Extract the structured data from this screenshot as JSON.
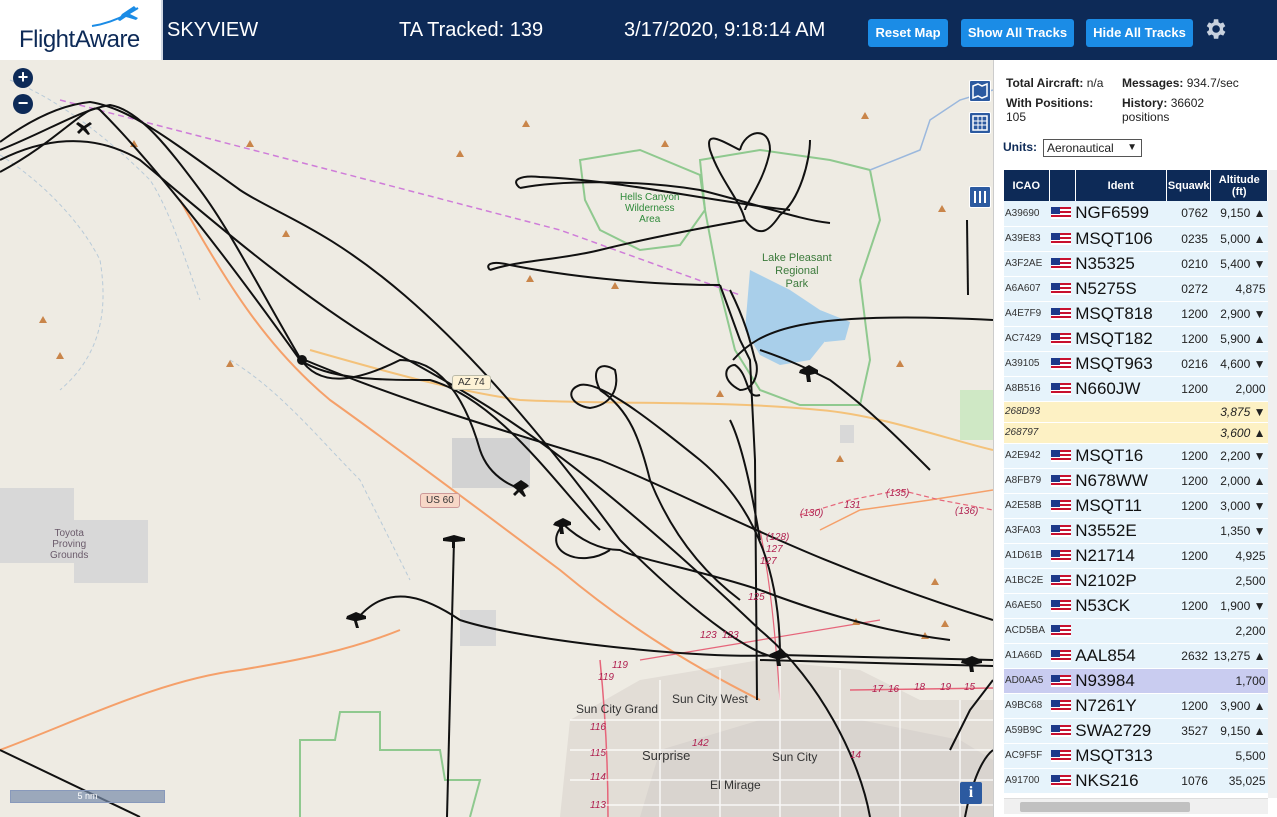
{
  "header": {
    "logo_text": "FlightAware",
    "app_title": "SKYVIEW",
    "tracked": "TA Tracked: 139",
    "datetime": "3/17/2020, 9:18:14 AM",
    "buttons": {
      "reset": "Reset Map",
      "show_all": "Show All Tracks",
      "hide_all": "Hide All Tracks"
    }
  },
  "map": {
    "zoom_in": "+",
    "zoom_out": "−",
    "scale": "5 nm",
    "info": "i",
    "labels": {
      "hells_canyon": "Hells Canyon\nWilderness\nArea",
      "lake_pleasant": "Lake Pleasant\nRegional\nPark",
      "toyota": "Toyota\nProving\nGrounds",
      "az74": "AZ 74",
      "us60": "US 60",
      "sun_city_grand": "Sun City Grand",
      "sun_city_west": "Sun City West",
      "surprise": "Surprise",
      "sun_city": "Sun City",
      "el_mirage": "El Mirage"
    },
    "route_numbers": [
      "(128)",
      "127",
      "127",
      "125",
      "123",
      "123",
      "119",
      "119",
      "116",
      "115",
      "114",
      "113",
      "142",
      "131",
      "(130)",
      "(135)",
      "(136)",
      "14",
      "17",
      "16",
      "18",
      "19",
      "15"
    ]
  },
  "panel": {
    "stats": {
      "total_label": "Total Aircraft:",
      "total_value": "n/a",
      "messages_label": "Messages:",
      "messages_value": "934.7/sec",
      "positions_label": "With Positions:",
      "positions_value": "105",
      "history_label": "History:",
      "history_value": "36602",
      "history_unit": "positions"
    },
    "units_label": "Units:",
    "units_value": "Aeronautical",
    "columns": [
      "ICAO",
      "",
      "Ident",
      "Squawk",
      "Altitude (ft)"
    ],
    "rows": [
      {
        "icao": "A39690",
        "ident": "NGF6599",
        "squawk": "0762",
        "alt": "9,150 ▲"
      },
      {
        "icao": "A39E83",
        "ident": "MSQT106",
        "squawk": "0235",
        "alt": "5,000 ▲"
      },
      {
        "icao": "A3F2AE",
        "ident": "N35325",
        "squawk": "0210",
        "alt": "5,400 ▼"
      },
      {
        "icao": "A6A607",
        "ident": "N5275S",
        "squawk": "0272",
        "alt": "4,875"
      },
      {
        "icao": "A4E7F9",
        "ident": "MSQT818",
        "squawk": "1200",
        "alt": "2,900 ▼"
      },
      {
        "icao": "AC7429",
        "ident": "MSQT182",
        "squawk": "1200",
        "alt": "5,900 ▲"
      },
      {
        "icao": "A39105",
        "ident": "MSQT963",
        "squawk": "0216",
        "alt": "4,600 ▼"
      },
      {
        "icao": "A8B516",
        "ident": "N660JW",
        "squawk": "1200",
        "alt": "2,000"
      },
      {
        "icao": "268D93",
        "ident": "",
        "squawk": "",
        "alt": "3,875 ▼",
        "style": "yellow"
      },
      {
        "icao": "268797",
        "ident": "",
        "squawk": "",
        "alt": "3,600 ▲",
        "style": "yellow"
      },
      {
        "icao": "A2E942",
        "ident": "MSQT16",
        "squawk": "1200",
        "alt": "2,200 ▼"
      },
      {
        "icao": "A8FB79",
        "ident": "N678WW",
        "squawk": "1200",
        "alt": "2,000 ▲"
      },
      {
        "icao": "A2E58B",
        "ident": "MSQT11",
        "squawk": "1200",
        "alt": "3,000 ▼"
      },
      {
        "icao": "A3FA03",
        "ident": "N3552E",
        "squawk": "",
        "alt": "1,350 ▼"
      },
      {
        "icao": "A1D61B",
        "ident": "N21714",
        "squawk": "1200",
        "alt": "4,925"
      },
      {
        "icao": "A1BC2E",
        "ident": "N2102P",
        "squawk": "",
        "alt": "2,500"
      },
      {
        "icao": "A6AE50",
        "ident": "N53CK",
        "squawk": "1200",
        "alt": "1,900 ▼"
      },
      {
        "icao": "ACD5BA",
        "ident": "",
        "squawk": "",
        "alt": "2,200"
      },
      {
        "icao": "A1A66D",
        "ident": "AAL854",
        "squawk": "2632",
        "alt": "13,275 ▲"
      },
      {
        "icao": "AD0AA5",
        "ident": "N93984",
        "squawk": "",
        "alt": "1,700",
        "style": "sel"
      },
      {
        "icao": "A9BC68",
        "ident": "N7261Y",
        "squawk": "1200",
        "alt": "3,900 ▲"
      },
      {
        "icao": "A59B9C",
        "ident": "SWA2729",
        "squawk": "3527",
        "alt": "9,150 ▲"
      },
      {
        "icao": "AC9F5F",
        "ident": "MSQT313",
        "squawk": "",
        "alt": "5,500"
      },
      {
        "icao": "A91700",
        "ident": "NKS216",
        "squawk": "1076",
        "alt": "35,025"
      }
    ]
  },
  "colors": {
    "header_bg": "#0d2a57",
    "button_bg": "#1b8ce6",
    "row_bg": "#e6f3fb",
    "row_yellow": "#fdf1c4",
    "row_selected": "#c9ccf0"
  }
}
